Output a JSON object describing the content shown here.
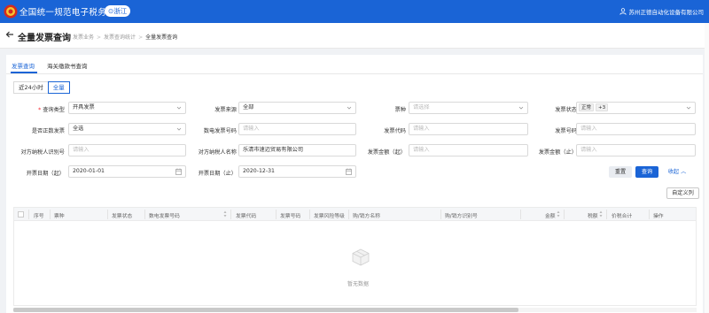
{
  "header": {
    "app_title": "全国统一规范电子税务局",
    "region": "浙江",
    "user": "苏州正德自动化设备有限公司"
  },
  "page": {
    "title": "全量发票查询",
    "breadcrumb": [
      "发票业务",
      "发票查询统计",
      "全量发票查询"
    ]
  },
  "tabs": [
    "发票查询",
    "海关缴款书查询"
  ],
  "range_toggle": {
    "options": [
      "近24小时",
      "全量"
    ],
    "selected": "全量"
  },
  "filters": {
    "query_type": {
      "label": "查询类型",
      "value": "开具发票"
    },
    "invoice_source": {
      "label": "发票来源",
      "value": "全部"
    },
    "invoice_kind": {
      "label": "票种",
      "placeholder": "请选择"
    },
    "invoice_status": {
      "label": "发票状态",
      "tag": "正常",
      "more": "+3"
    },
    "is_positive": {
      "label": "是否正数发票",
      "value": "全选"
    },
    "digital_no": {
      "label": "数电发票号码",
      "placeholder": "请输入"
    },
    "invoice_code": {
      "label": "发票代码",
      "placeholder": "请输入"
    },
    "invoice_no": {
      "label": "发票号码",
      "placeholder": "请输入"
    },
    "buyer_tax_id": {
      "label": "对方纳税人识别号",
      "placeholder": "请输入"
    },
    "buyer_name": {
      "label": "对方纳税人名称",
      "value": "乐清市速迈贸易有限公司"
    },
    "amount_from": {
      "label": "发票金额（起）",
      "placeholder": "请输入"
    },
    "amount_to": {
      "label": "发票金额（止）",
      "placeholder": "请输入"
    },
    "date_from": {
      "label": "开票日期（起）",
      "value": "2020-01-01"
    },
    "date_to": {
      "label": "开票日期（止）",
      "value": "2020-12-31"
    }
  },
  "actions": {
    "reset": "重置",
    "query": "查询",
    "collapse": "收起",
    "custom_columns": "自定义列"
  },
  "table": {
    "columns": [
      "序号",
      "票种",
      "发票状态",
      "数电发票号码",
      "发票代码",
      "发票号码",
      "发票风险等级",
      "购/销方名称",
      "购/销方识别号",
      "金额",
      "税额",
      "价税合计",
      "操作"
    ],
    "empty_text": "暂无数据"
  },
  "colors": {
    "primary": "#1a64d6",
    "required": "#f5222d"
  }
}
